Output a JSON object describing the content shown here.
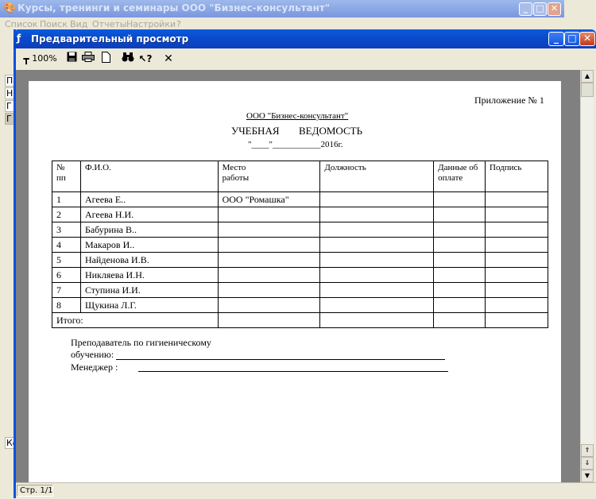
{
  "bg_window": {
    "title": "Курсы, тренинги и семинары ООО \"Бизнес-консультант\"",
    "menu": [
      "Список",
      "Поиск",
      "Вид",
      "Отчеты",
      "Настройки",
      "?"
    ],
    "side_cells": [
      "П",
      "Н",
      "Г",
      "Г"
    ],
    "side_bottom": "Ко"
  },
  "preview_window": {
    "title": "Предварительный просмотр",
    "status": "Стр. 1/1"
  },
  "toolbar": {
    "zoom_label": "100%"
  },
  "document": {
    "appendix": "Приложение № 1",
    "org": "ООО \"Бизнес-консультант\"",
    "heading_left": "УЧЕБНАЯ",
    "heading_right": "ВЕДОМОСТЬ",
    "date_line": "\"____\"___________2016г.",
    "table": {
      "headers": [
        "№\nпп",
        "Ф.И.О.",
        "Место\nработы",
        "Должность",
        "Данные об\nоплате",
        "Подпись"
      ],
      "rows": [
        {
          "num": "1",
          "name": "Агеева Е..",
          "work": "ООО \"Ромашка\""
        },
        {
          "num": "2",
          "name": "Агеева Н.И.",
          "work": ""
        },
        {
          "num": "3",
          "name": "Бабурина В..",
          "work": ""
        },
        {
          "num": "4",
          "name": "Макаров И..",
          "work": ""
        },
        {
          "num": "5",
          "name": "Найденова И.В.",
          "work": ""
        },
        {
          "num": "6",
          "name": "Никляева И.Н.",
          "work": ""
        },
        {
          "num": "7",
          "name": "Ступина И.И.",
          "work": ""
        },
        {
          "num": "8",
          "name": "Щукина Л.Г.",
          "work": ""
        }
      ],
      "total_label": "Итого:"
    },
    "sign_teacher_1": "Преподаватель по гигиеническому",
    "sign_teacher_2": "обучению:",
    "sign_manager": "Менеджер    :"
  }
}
